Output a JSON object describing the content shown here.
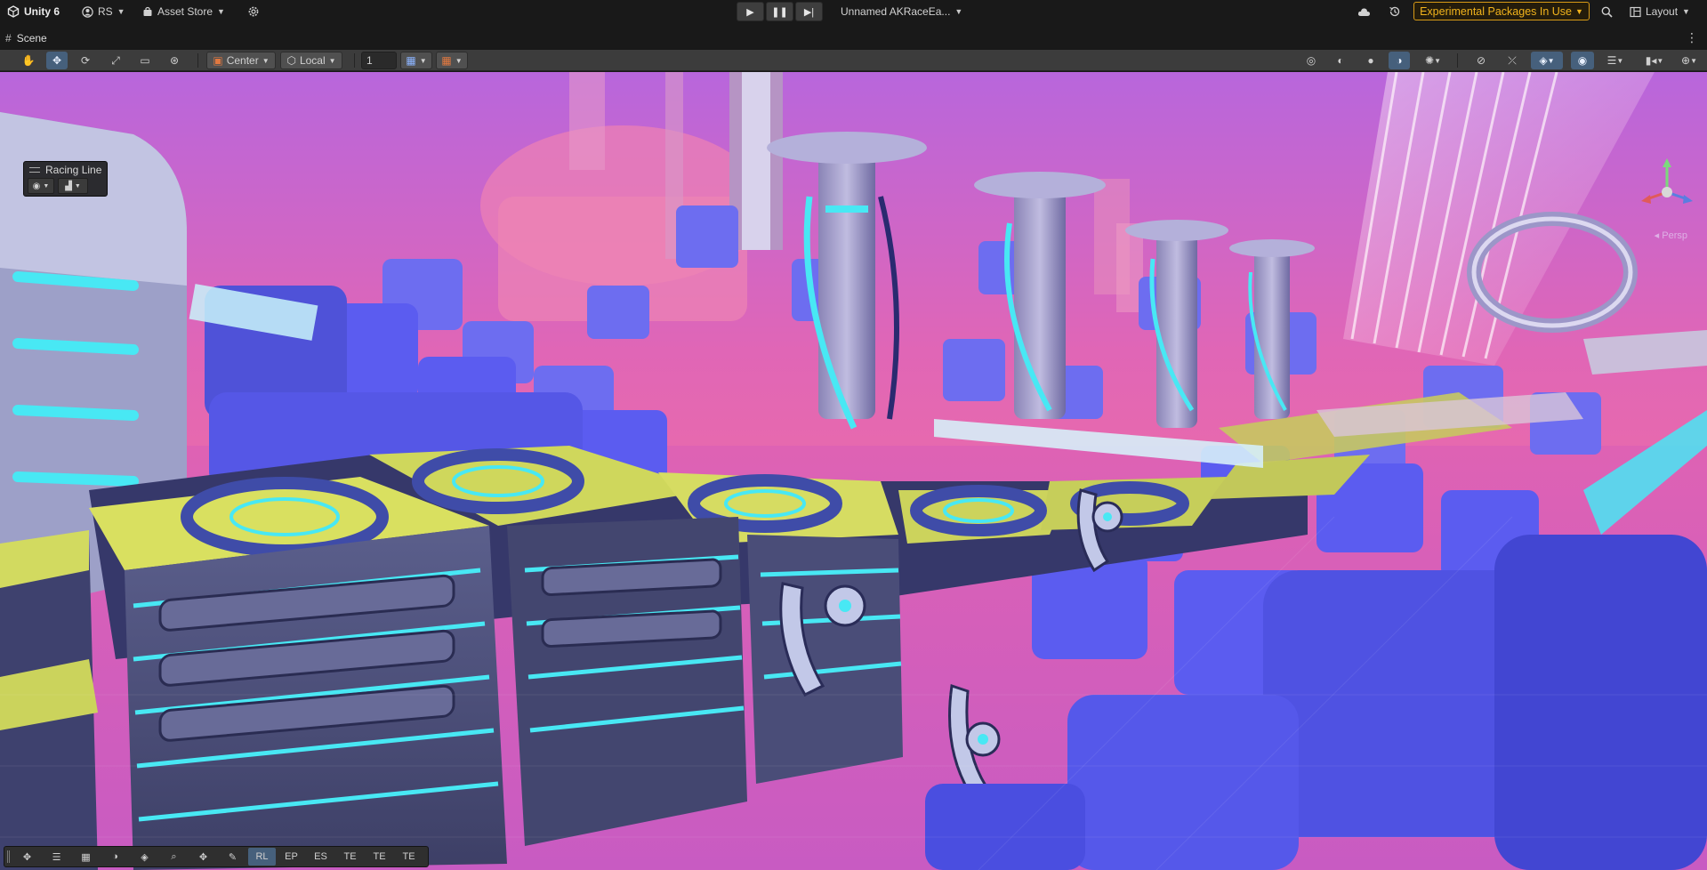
{
  "topbar": {
    "unity_label": "Unity 6",
    "account_label": "RS",
    "asset_store_label": "Asset Store",
    "project_label": "Unnamed AKRaceEa...",
    "experimental_label": "Experimental Packages In Use",
    "layout_label": "Layout"
  },
  "tabs": {
    "scene_label": "Scene"
  },
  "scene_toolbar": {
    "pivot_label": "Center",
    "space_label": "Local",
    "grid_value": "1"
  },
  "overlay": {
    "title": "Racing Line"
  },
  "bottom_toolbar": {
    "buttons": [
      "RL",
      "EP",
      "ES",
      "TE",
      "TE",
      "TE"
    ]
  },
  "colors": {
    "accent_active": "#46607c",
    "experimental": "#f1b31c",
    "sky_top": "#c26ad8",
    "sky_horizon": "#f06ea4",
    "track_yellow": "#d9e060",
    "neon_cyan": "#48e8f4",
    "block_blue": "#5a5ef2"
  }
}
